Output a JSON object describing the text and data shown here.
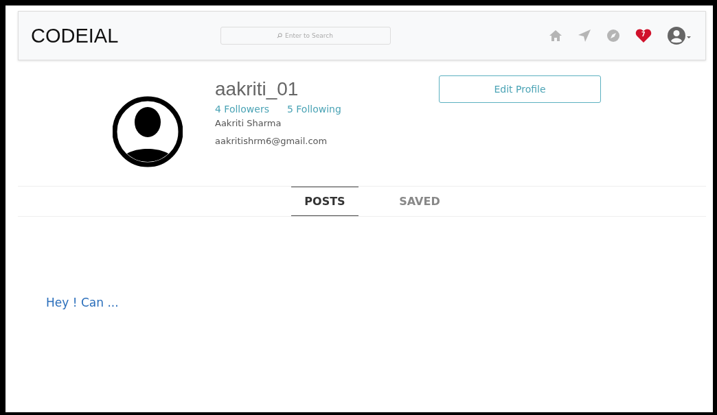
{
  "navbar": {
    "brand": "CODEIAL",
    "search": {
      "placeholder": "Enter to Search"
    },
    "notifications_badge": "7"
  },
  "profile": {
    "username": "aakriti_01",
    "followers": "4 Followers",
    "following": "5 Following",
    "full_name": "Aakriti Sharma",
    "email": "aakritishrm6@gmail.com",
    "edit_button": "Edit Profile"
  },
  "tabs": [
    {
      "label": "POSTS",
      "selected": true
    },
    {
      "label": "SAVED",
      "selected": false
    }
  ],
  "posts": [
    {
      "text": "Hey ! Can ..."
    }
  ]
}
